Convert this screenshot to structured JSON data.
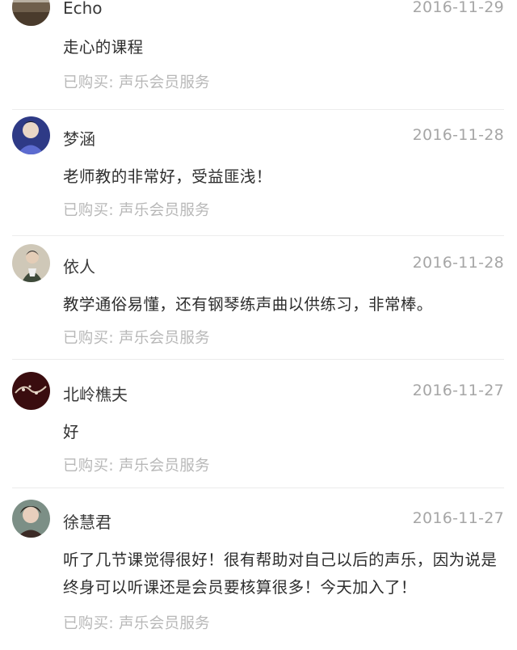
{
  "reviews": [
    {
      "name": "Echo",
      "date": "2016-11-29",
      "comment": "走心的课程",
      "purchase": "已购买: 声乐会员服务",
      "avatar_icon": "avatar-landscape-icon"
    },
    {
      "name": "梦涵",
      "date": "2016-11-28",
      "comment": "老师教的非常好，受益匪浅！",
      "purchase": "已购买: 声乐会员服务",
      "avatar_icon": "avatar-portrait-icon"
    },
    {
      "name": "依人",
      "date": "2016-11-28",
      "comment": "教学通俗易懂，还有钢琴练声曲以供练习，非常棒。",
      "purchase": "已购买: 声乐会员服务",
      "avatar_icon": "avatar-portrait-icon"
    },
    {
      "name": "北岭樵夫",
      "date": "2016-11-27",
      "comment": "好",
      "purchase": "已购买: 声乐会员服务",
      "avatar_icon": "avatar-dark-art-icon"
    },
    {
      "name": "徐慧君",
      "date": "2016-11-27",
      "comment": "听了几节课觉得很好！很有帮助对自己以后的声乐，因为说是终身可以听课还是会员要核算很多！今天加入了！",
      "purchase": "已购买: 声乐会员服务",
      "avatar_icon": "avatar-portrait-icon"
    }
  ],
  "colors": {
    "name": "#3a3a3a",
    "date": "#a6a6a6",
    "comment": "#2d2d2d",
    "purchase": "#b8b8b8",
    "divider": "#ececec"
  }
}
